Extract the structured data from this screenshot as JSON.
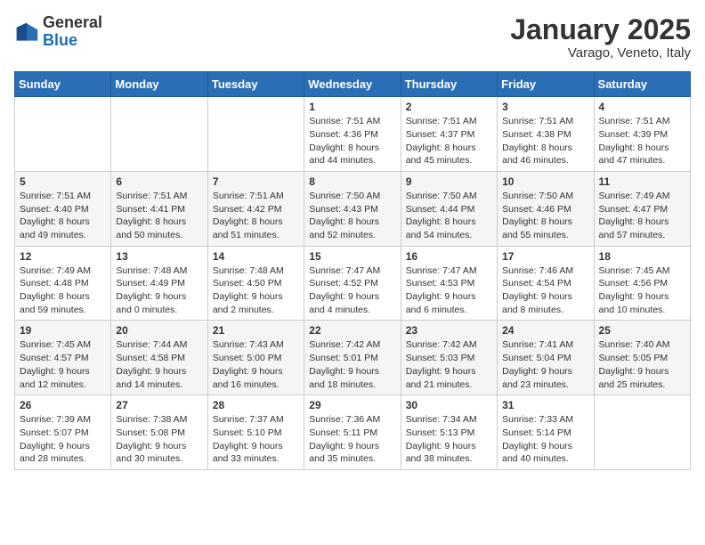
{
  "header": {
    "logo_general": "General",
    "logo_blue": "Blue",
    "month_title": "January 2025",
    "location": "Varago, Veneto, Italy"
  },
  "weekdays": [
    "Sunday",
    "Monday",
    "Tuesday",
    "Wednesday",
    "Thursday",
    "Friday",
    "Saturday"
  ],
  "weeks": [
    [
      {
        "day": "",
        "info": ""
      },
      {
        "day": "",
        "info": ""
      },
      {
        "day": "",
        "info": ""
      },
      {
        "day": "1",
        "info": "Sunrise: 7:51 AM\nSunset: 4:36 PM\nDaylight: 8 hours\nand 44 minutes."
      },
      {
        "day": "2",
        "info": "Sunrise: 7:51 AM\nSunset: 4:37 PM\nDaylight: 8 hours\nand 45 minutes."
      },
      {
        "day": "3",
        "info": "Sunrise: 7:51 AM\nSunset: 4:38 PM\nDaylight: 8 hours\nand 46 minutes."
      },
      {
        "day": "4",
        "info": "Sunrise: 7:51 AM\nSunset: 4:39 PM\nDaylight: 8 hours\nand 47 minutes."
      }
    ],
    [
      {
        "day": "5",
        "info": "Sunrise: 7:51 AM\nSunset: 4:40 PM\nDaylight: 8 hours\nand 49 minutes."
      },
      {
        "day": "6",
        "info": "Sunrise: 7:51 AM\nSunset: 4:41 PM\nDaylight: 8 hours\nand 50 minutes."
      },
      {
        "day": "7",
        "info": "Sunrise: 7:51 AM\nSunset: 4:42 PM\nDaylight: 8 hours\nand 51 minutes."
      },
      {
        "day": "8",
        "info": "Sunrise: 7:50 AM\nSunset: 4:43 PM\nDaylight: 8 hours\nand 52 minutes."
      },
      {
        "day": "9",
        "info": "Sunrise: 7:50 AM\nSunset: 4:44 PM\nDaylight: 8 hours\nand 54 minutes."
      },
      {
        "day": "10",
        "info": "Sunrise: 7:50 AM\nSunset: 4:46 PM\nDaylight: 8 hours\nand 55 minutes."
      },
      {
        "day": "11",
        "info": "Sunrise: 7:49 AM\nSunset: 4:47 PM\nDaylight: 8 hours\nand 57 minutes."
      }
    ],
    [
      {
        "day": "12",
        "info": "Sunrise: 7:49 AM\nSunset: 4:48 PM\nDaylight: 8 hours\nand 59 minutes."
      },
      {
        "day": "13",
        "info": "Sunrise: 7:48 AM\nSunset: 4:49 PM\nDaylight: 9 hours\nand 0 minutes."
      },
      {
        "day": "14",
        "info": "Sunrise: 7:48 AM\nSunset: 4:50 PM\nDaylight: 9 hours\nand 2 minutes."
      },
      {
        "day": "15",
        "info": "Sunrise: 7:47 AM\nSunset: 4:52 PM\nDaylight: 9 hours\nand 4 minutes."
      },
      {
        "day": "16",
        "info": "Sunrise: 7:47 AM\nSunset: 4:53 PM\nDaylight: 9 hours\nand 6 minutes."
      },
      {
        "day": "17",
        "info": "Sunrise: 7:46 AM\nSunset: 4:54 PM\nDaylight: 9 hours\nand 8 minutes."
      },
      {
        "day": "18",
        "info": "Sunrise: 7:45 AM\nSunset: 4:56 PM\nDaylight: 9 hours\nand 10 minutes."
      }
    ],
    [
      {
        "day": "19",
        "info": "Sunrise: 7:45 AM\nSunset: 4:57 PM\nDaylight: 9 hours\nand 12 minutes."
      },
      {
        "day": "20",
        "info": "Sunrise: 7:44 AM\nSunset: 4:58 PM\nDaylight: 9 hours\nand 14 minutes."
      },
      {
        "day": "21",
        "info": "Sunrise: 7:43 AM\nSunset: 5:00 PM\nDaylight: 9 hours\nand 16 minutes."
      },
      {
        "day": "22",
        "info": "Sunrise: 7:42 AM\nSunset: 5:01 PM\nDaylight: 9 hours\nand 18 minutes."
      },
      {
        "day": "23",
        "info": "Sunrise: 7:42 AM\nSunset: 5:03 PM\nDaylight: 9 hours\nand 21 minutes."
      },
      {
        "day": "24",
        "info": "Sunrise: 7:41 AM\nSunset: 5:04 PM\nDaylight: 9 hours\nand 23 minutes."
      },
      {
        "day": "25",
        "info": "Sunrise: 7:40 AM\nSunset: 5:05 PM\nDaylight: 9 hours\nand 25 minutes."
      }
    ],
    [
      {
        "day": "26",
        "info": "Sunrise: 7:39 AM\nSunset: 5:07 PM\nDaylight: 9 hours\nand 28 minutes."
      },
      {
        "day": "27",
        "info": "Sunrise: 7:38 AM\nSunset: 5:08 PM\nDaylight: 9 hours\nand 30 minutes."
      },
      {
        "day": "28",
        "info": "Sunrise: 7:37 AM\nSunset: 5:10 PM\nDaylight: 9 hours\nand 33 minutes."
      },
      {
        "day": "29",
        "info": "Sunrise: 7:36 AM\nSunset: 5:11 PM\nDaylight: 9 hours\nand 35 minutes."
      },
      {
        "day": "30",
        "info": "Sunrise: 7:34 AM\nSunset: 5:13 PM\nDaylight: 9 hours\nand 38 minutes."
      },
      {
        "day": "31",
        "info": "Sunrise: 7:33 AM\nSunset: 5:14 PM\nDaylight: 9 hours\nand 40 minutes."
      },
      {
        "day": "",
        "info": ""
      }
    ]
  ]
}
